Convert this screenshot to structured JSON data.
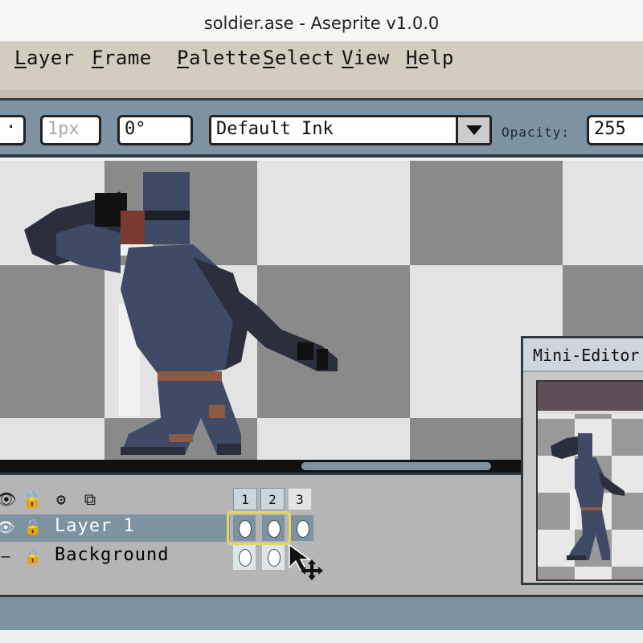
{
  "window": {
    "title": "soldier.ase - Aseprite v1.0.0"
  },
  "menubar": {
    "items": [
      {
        "first": "L",
        "rest": "ayer"
      },
      {
        "first": "F",
        "rest": "rame"
      },
      {
        "first": "P",
        "rest": "alette"
      },
      {
        "first": "S",
        "rest": "elect"
      },
      {
        "first": "V",
        "rest": "iew"
      },
      {
        "first": "H",
        "rest": "elp"
      }
    ]
  },
  "toolbar": {
    "brush_size": "1px",
    "angle": "0°",
    "ink": "Default Ink",
    "opacity_label": "Opacity:",
    "opacity_value": "255"
  },
  "timeline": {
    "frames": [
      "1",
      "2",
      "3"
    ],
    "layers": [
      {
        "name": "Layer 1",
        "selected": true
      },
      {
        "name": "Background",
        "selected": false
      }
    ]
  },
  "mini_editor": {
    "title": "Mini-Editor"
  },
  "colors": {
    "accent": "#7d93a1",
    "dark": "#2f3a42",
    "selection": "#e8d85a",
    "armor": "#3e4a66",
    "armor_dark": "#2b2f3c",
    "belt": "#8a5a44"
  }
}
